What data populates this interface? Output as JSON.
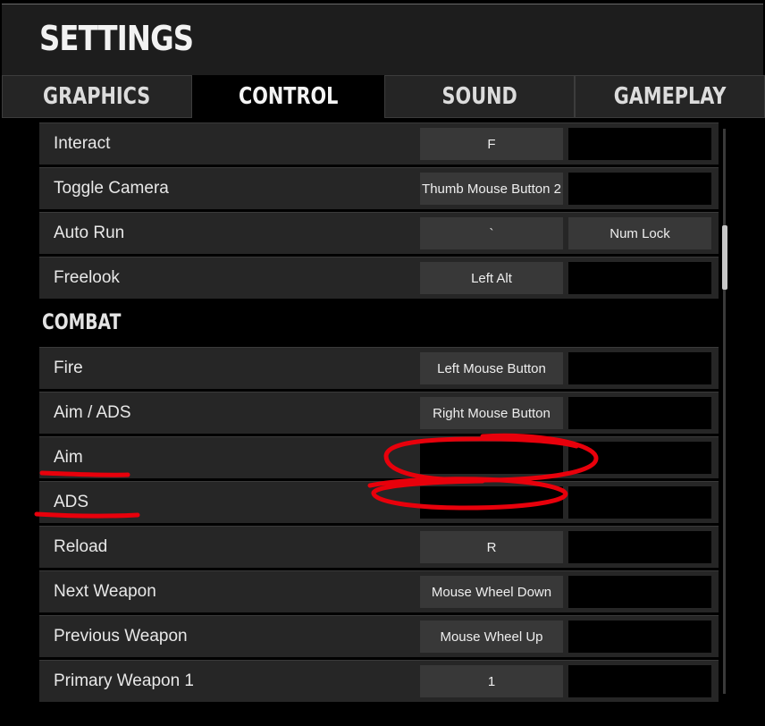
{
  "window": {
    "title": "SETTINGS"
  },
  "tabs": [
    {
      "label": "GRAPHICS",
      "active": false
    },
    {
      "label": "CONTROL",
      "active": true
    },
    {
      "label": "SOUND",
      "active": false
    },
    {
      "label": "GAMEPLAY",
      "active": false
    }
  ],
  "movement_rows": [
    {
      "action": "Interact",
      "primary": "F",
      "secondary": ""
    },
    {
      "action": "Toggle Camera",
      "primary": "Thumb Mouse Button 2",
      "secondary": ""
    },
    {
      "action": "Auto Run",
      "primary": "`",
      "secondary": "Num Lock"
    },
    {
      "action": "Freelook",
      "primary": "Left Alt",
      "secondary": ""
    }
  ],
  "combat": {
    "title": "COMBAT",
    "rows": [
      {
        "action": "Fire",
        "primary": "Left Mouse Button",
        "secondary": ""
      },
      {
        "action": "Aim / ADS",
        "primary": "Right Mouse Button",
        "secondary": ""
      },
      {
        "action": "Aim",
        "primary": "",
        "secondary": ""
      },
      {
        "action": "ADS",
        "primary": "",
        "secondary": ""
      },
      {
        "action": "Reload",
        "primary": "R",
        "secondary": ""
      },
      {
        "action": "Next Weapon",
        "primary": "Mouse Wheel Down",
        "secondary": ""
      },
      {
        "action": "Previous Weapon",
        "primary": "Mouse Wheel Up",
        "secondary": ""
      },
      {
        "action": "Primary Weapon 1",
        "primary": "1",
        "secondary": ""
      }
    ]
  },
  "colors": {
    "annotation": "#e8000b",
    "row_bg": "#262626",
    "key_bg": "#383838",
    "title_bar": "#1d1d1d"
  }
}
